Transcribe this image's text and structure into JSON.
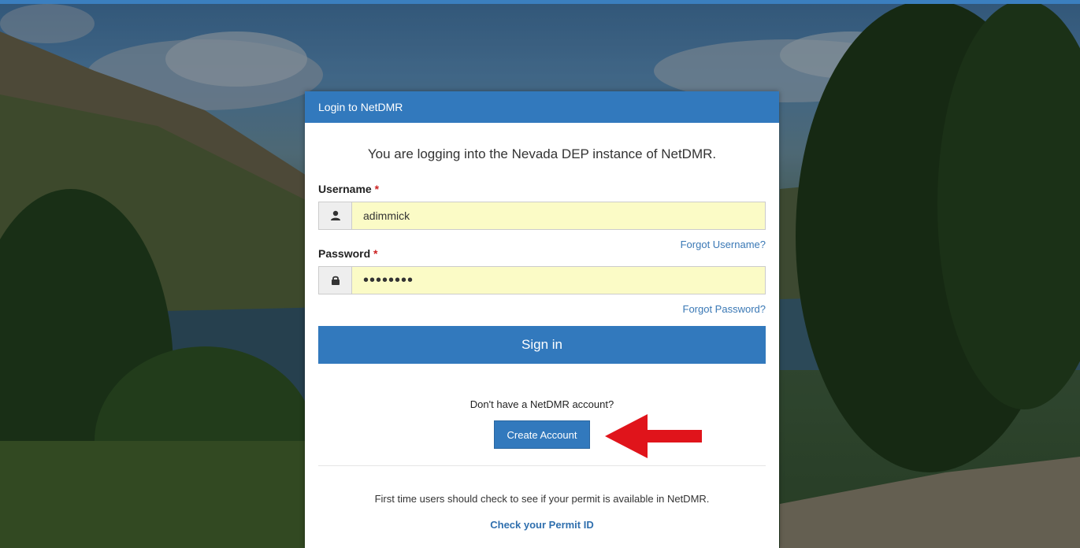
{
  "header": {
    "title": "Login to NetDMR"
  },
  "intro_text": "You are logging into the Nevada DEP instance of NetDMR.",
  "username": {
    "label": "Username",
    "required_mark": "*",
    "value": "adimmick",
    "icon": "user-icon",
    "forgot_link": "Forgot Username?"
  },
  "password": {
    "label": "Password",
    "required_mark": "*",
    "masked_value": "••••••••",
    "icon": "lock-icon",
    "forgot_link": "Forgot Password?"
  },
  "signin_label": "Sign in",
  "no_account_text": "Don't have a NetDMR account?",
  "create_account_label": "Create Account",
  "first_time_text": "First time users should check to see if your permit is available in NetDMR.",
  "check_permit_link": "Check your Permit ID",
  "colors": {
    "primary": "#3279bd",
    "input_autofill": "#fbfbc6",
    "required": "#cc2222",
    "annotation_arrow": "#e0141b"
  }
}
